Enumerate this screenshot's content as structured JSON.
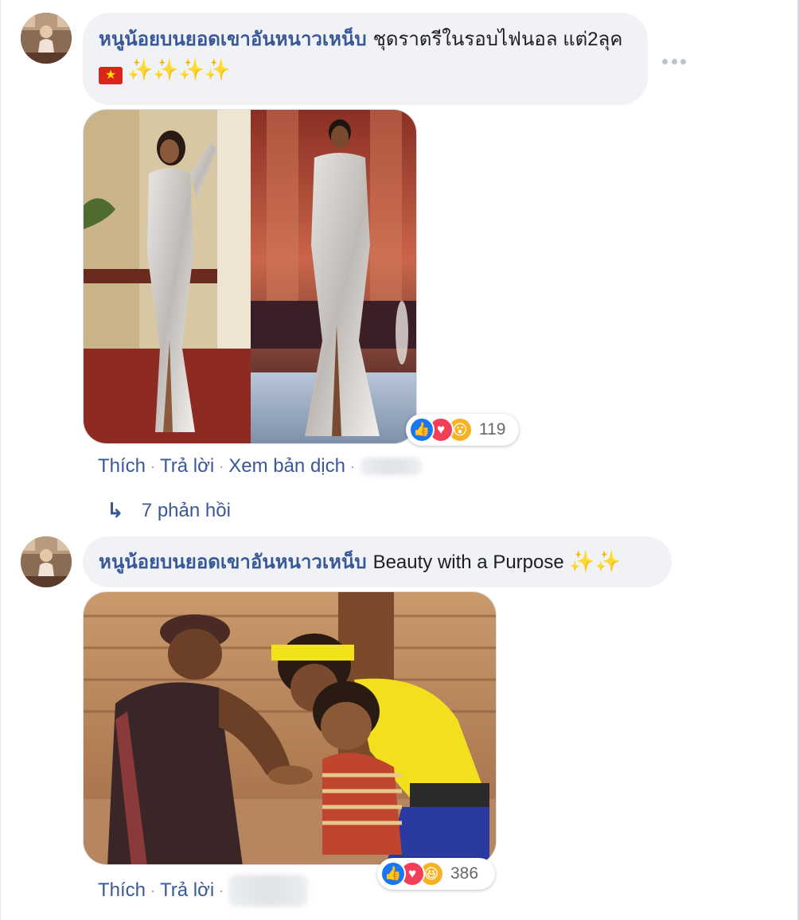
{
  "comments": [
    {
      "author": "หนูน้อยบนยอดเขาอันหนาวเหน็บ",
      "text": "ชุดราตรีในรอบไฟนอล แต่2ลุค",
      "flag_emoji": "🇻🇳",
      "sparkles": "✨✨✨✨",
      "reaction_types": [
        "like-icon",
        "love-icon",
        "wow-icon"
      ],
      "reaction_count": "119",
      "actions": {
        "like": "Thích",
        "reply": "Trả lời",
        "translate": "Xem bản dịch"
      },
      "replies_label": "7 phản hồi"
    },
    {
      "author": "หนูน้อยบนยอดเขาอันหนาวเหน็บ",
      "text": "Beauty with a Purpose",
      "sparkles": "✨✨",
      "reaction_types": [
        "like-icon",
        "love-icon",
        "haha-icon"
      ],
      "reaction_count": "386",
      "actions": {
        "like": "Thích",
        "reply": "Trả lời"
      }
    }
  ],
  "colors": {
    "author_link": "#385898",
    "bubble_bg": "#f0f2f5",
    "like_blue": "#1877f2",
    "love_red": "#f33e58",
    "wow_yellow": "#f7b125"
  }
}
